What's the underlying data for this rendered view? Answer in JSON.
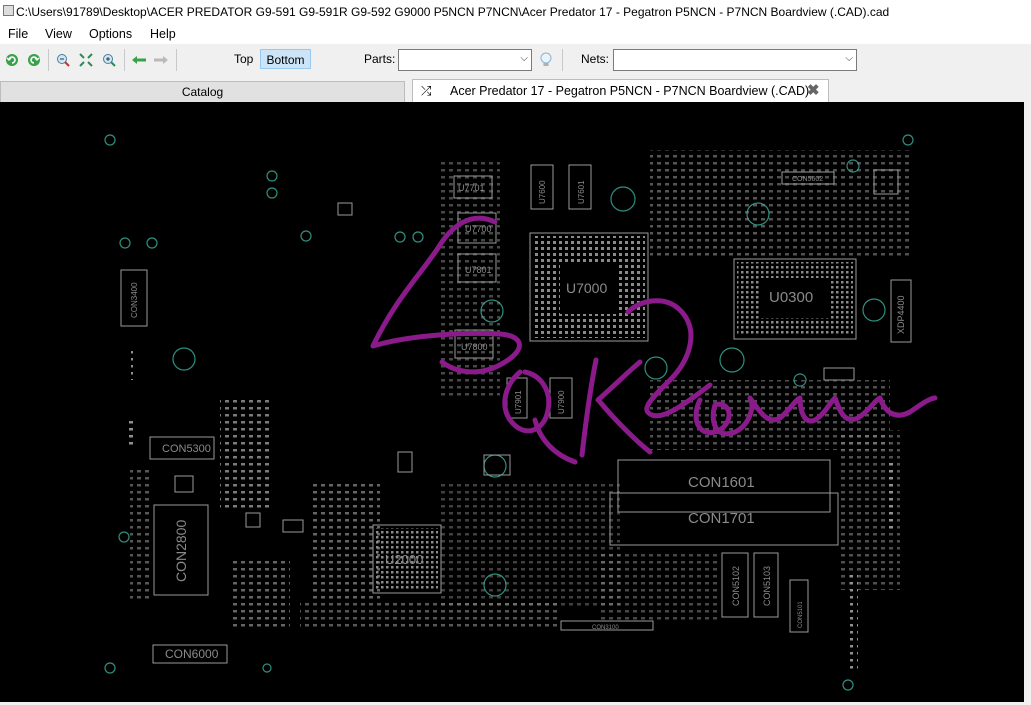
{
  "window": {
    "title": "C:\\Users\\91789\\Desktop\\ACER PREDATOR G9-591 G9-591R G9-592 G9000 P5NCN P7NCN\\Acer Predator 17  - Pegatron P5NCN - P7NCN Boardview (.CAD).cad"
  },
  "menu": {
    "file": "File",
    "view": "View",
    "options": "Options",
    "help": "Help"
  },
  "toolbar": {
    "icons": [
      "rotate-left-icon",
      "rotate-right-icon",
      "zoom-out-icon",
      "fit-icon",
      "zoom-in-icon",
      "back-arrow-icon",
      "forward-arrow-icon"
    ],
    "top_label": "Top",
    "bottom_label": "Bottom",
    "parts_label": "Parts:",
    "parts_value": "",
    "nets_label": "Nets:",
    "nets_value": ""
  },
  "tabs": {
    "catalog": "Catalog",
    "document": "Acer Predator 17  - Pegatron P5NCN - P7NCN Boardview (.CAD)"
  },
  "board": {
    "components": {
      "u7701": "U7701",
      "u7700": "U7700",
      "u7801": "U7801",
      "u7800": "U7800",
      "u7000": "U7000",
      "u0300": "U0300",
      "u2000": "U2000",
      "con3400": "CON3400",
      "con5300": "CON5300",
      "con2800": "CON2800",
      "con6000": "CON6000",
      "con1601": "CON1601",
      "con1701": "CON1701",
      "con5102": "CON5102",
      "con5103": "CON5103",
      "con5602": "CON5602",
      "xdp4400": "XDP4400",
      "u7600": "U7600",
      "u7601": "U7601",
      "u7901": "U7901",
      "u7900": "U7900",
      "con3100": "CON3100",
      "con5101": "CON5101"
    },
    "colors": {
      "background": "#000000",
      "silkscreen": "#9a9a9a",
      "chip_label": "#8a8a8a",
      "via": "#2f8f7f",
      "ink": "#8b1a8b"
    }
  }
}
